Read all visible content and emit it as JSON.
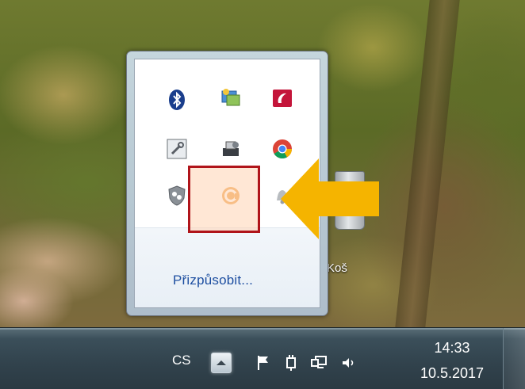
{
  "desktop": {
    "recycle_bin_label": "Koš"
  },
  "tray_popup": {
    "icons": [
      {
        "name": "bluetooth-icon"
      },
      {
        "name": "network-center-icon"
      },
      {
        "name": "red-app-icon"
      },
      {
        "name": "wrench-tool-icon"
      },
      {
        "name": "usb-eject-icon"
      },
      {
        "name": "chrome-icon"
      },
      {
        "name": "shield-app-icon"
      },
      {
        "name": "orange-circle-app-icon"
      },
      {
        "name": "notification-bell-icon"
      }
    ],
    "customize_link": "Přizpůsobit..."
  },
  "annotation": {
    "highlight_color": "#b0141a",
    "arrow_color": "#f5b400"
  },
  "taskbar": {
    "language": "CS",
    "icons": [
      "action-center-flag-icon",
      "power-plug-icon",
      "network-icon",
      "volume-icon"
    ],
    "clock": {
      "time": "14:33",
      "date": "10.5.2017"
    }
  }
}
